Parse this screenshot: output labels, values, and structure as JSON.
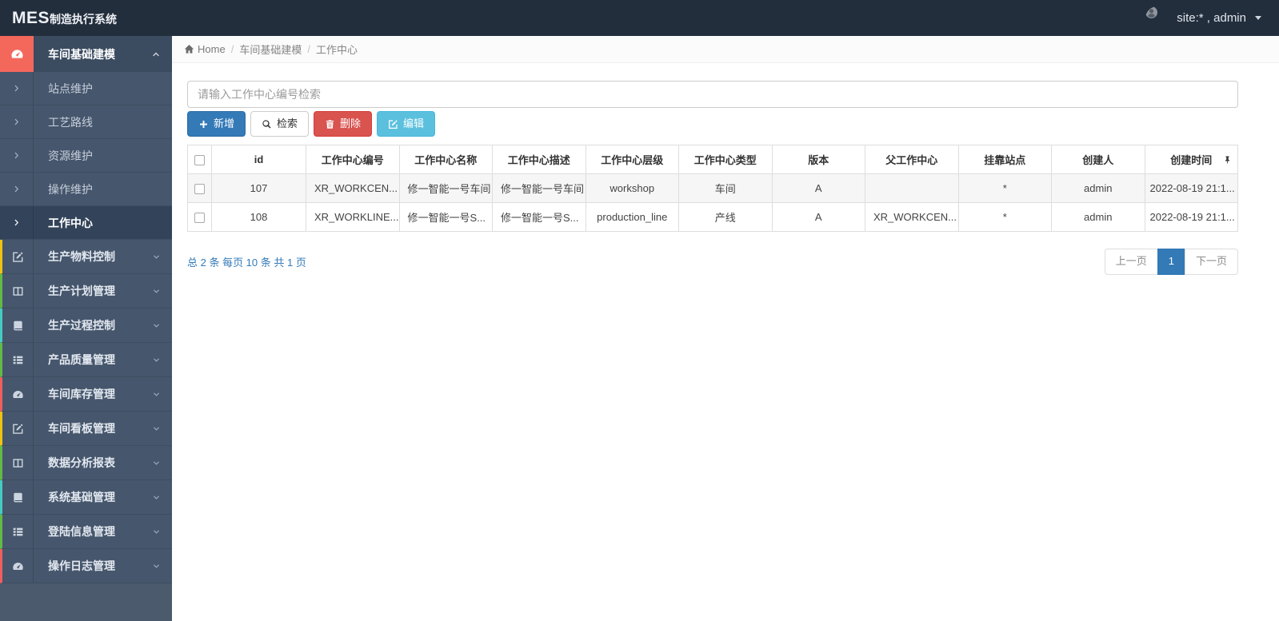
{
  "header": {
    "brand_mes": "MES",
    "brand_suffix": "制造执行系统",
    "user_label": "site:* , admin"
  },
  "sidebar": {
    "group": {
      "label": "车间基础建模",
      "icon": "tachometer-icon",
      "accent": "#f4685c"
    },
    "submenu": [
      {
        "label": "站点维护",
        "active": false
      },
      {
        "label": "工艺路线",
        "active": false
      },
      {
        "label": "资源维护",
        "active": false
      },
      {
        "label": "操作维护",
        "active": false
      },
      {
        "label": "工作中心",
        "active": true
      }
    ],
    "items": [
      {
        "label": "生产物料控制",
        "icon": "edit-icon",
        "accent": "#f0c30f"
      },
      {
        "label": "生产计划管理",
        "icon": "columns-icon",
        "accent": "#62ba46"
      },
      {
        "label": "生产过程控制",
        "icon": "book-icon",
        "accent": "#45cbc2"
      },
      {
        "label": "产品质量管理",
        "icon": "list-icon",
        "accent": "#62ba46"
      },
      {
        "label": "车间库存管理",
        "icon": "tachometer-icon",
        "accent": "#ef5f5c"
      },
      {
        "label": "车间看板管理",
        "icon": "edit-icon",
        "accent": "#f0c30f"
      },
      {
        "label": "数据分析报表",
        "icon": "columns-icon",
        "accent": "#62ba46"
      },
      {
        "label": "系统基础管理",
        "icon": "book-icon",
        "accent": "#45cbc2"
      },
      {
        "label": "登陆信息管理",
        "icon": "list-icon",
        "accent": "#62ba46"
      },
      {
        "label": "操作日志管理",
        "icon": "tachometer-icon",
        "accent": "#ef5f5c"
      }
    ]
  },
  "breadcrumb": {
    "home": "Home",
    "level1": "车间基础建模",
    "level2": "工作中心"
  },
  "toolbar": {
    "search_placeholder": "请输入工作中心编号检索",
    "add_label": "新增",
    "search_label": "检索",
    "delete_label": "删除",
    "edit_label": "编辑"
  },
  "table": {
    "headers": [
      "id",
      "工作中心编号",
      "工作中心名称",
      "工作中心描述",
      "工作中心层级",
      "工作中心类型",
      "版本",
      "父工作中心",
      "挂靠站点",
      "创建人",
      "创建时间"
    ],
    "left_aligned_columns": [
      1,
      2,
      3,
      7
    ],
    "rows": [
      [
        "107",
        "XR_WORKCEN...",
        "修一智能一号车间",
        "修一智能一号车间",
        "workshop",
        "车间",
        "A",
        "",
        "*",
        "admin",
        "2022-08-19 21:1..."
      ],
      [
        "108",
        "XR_WORKLINE...",
        "修一智能一号S...",
        "修一智能一号S...",
        "production_line",
        "产线",
        "A",
        "XR_WORKCEN...",
        "*",
        "admin",
        "2022-08-19 21:1..."
      ]
    ]
  },
  "pagination": {
    "summary": "总 2 条  每页 10 条  共 1 页",
    "prev_label": "上一页",
    "current_page": "1",
    "next_label": "下一页"
  },
  "colors": {
    "navbar": "#232e3d",
    "sidebar": "#46566c",
    "sidebar_active": "#33445a",
    "group_accent": "#f4685c",
    "primary": "#337ab7",
    "danger": "#d9534f",
    "info": "#5bc0de"
  }
}
